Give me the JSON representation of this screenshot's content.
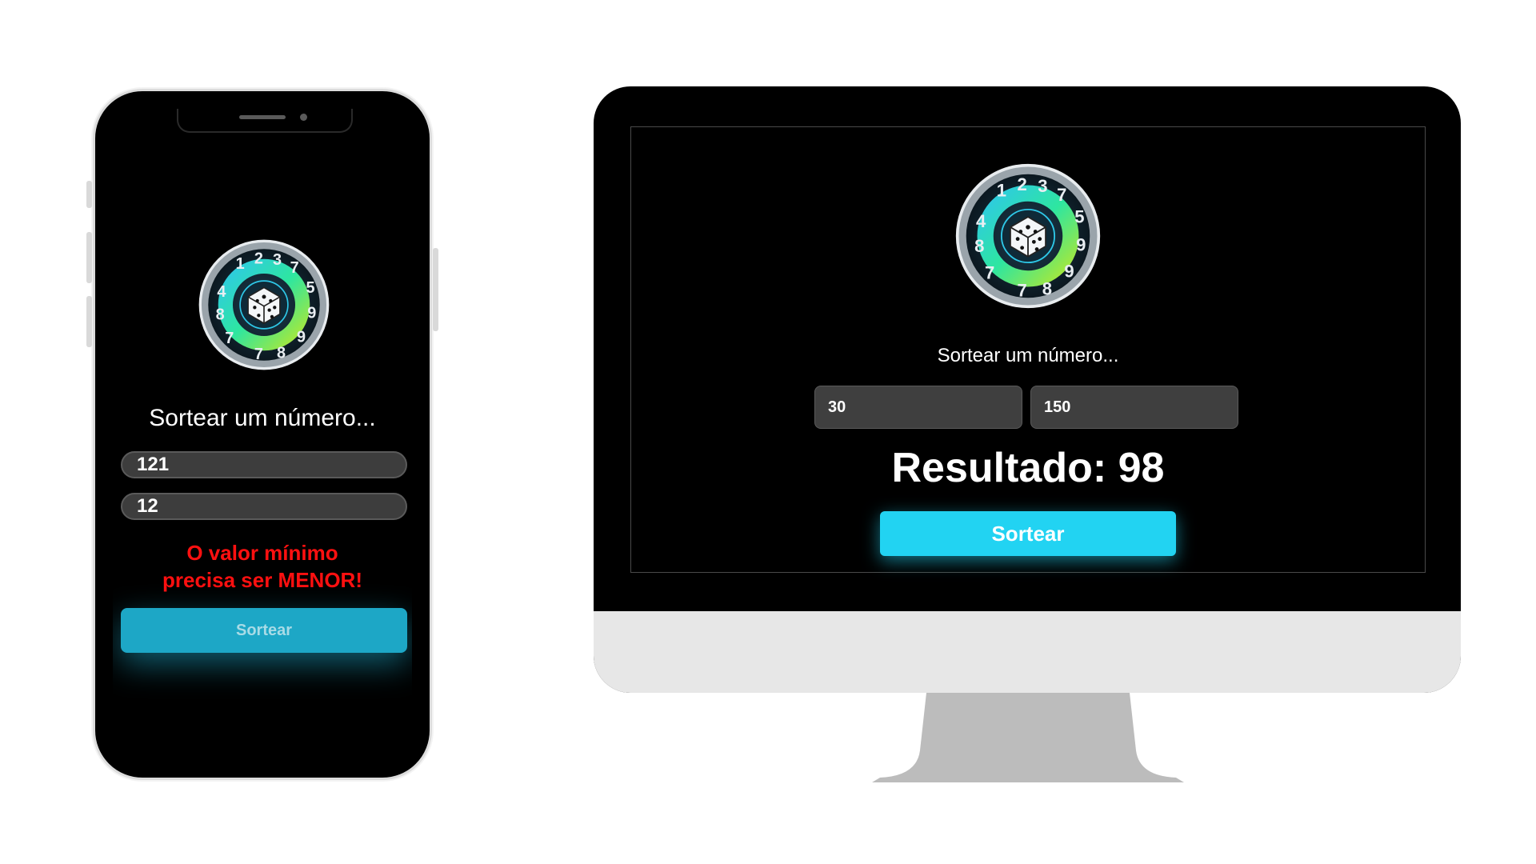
{
  "colors": {
    "screen_bg": "#000000",
    "input_bg": "#3d3d3d",
    "button_accent": "#22d3f2",
    "error_text": "#ff1010"
  },
  "logo": {
    "icon": "dice-wheel-logo-icon",
    "ring_numbers": [
      "1",
      "2",
      "3",
      "7",
      "5",
      "9",
      "9",
      "8",
      "7",
      "4",
      "8",
      "7"
    ]
  },
  "mobile": {
    "title": "Sortear um número...",
    "min_value": "121",
    "max_value": "12",
    "error_line1": "O valor mínimo",
    "error_line2": "precisa ser MENOR!",
    "button_label": "Sortear"
  },
  "desktop": {
    "title": "Sortear um número...",
    "min_value": "30",
    "max_value": "150",
    "result": "Resultado: 98",
    "button_label": "Sortear"
  }
}
